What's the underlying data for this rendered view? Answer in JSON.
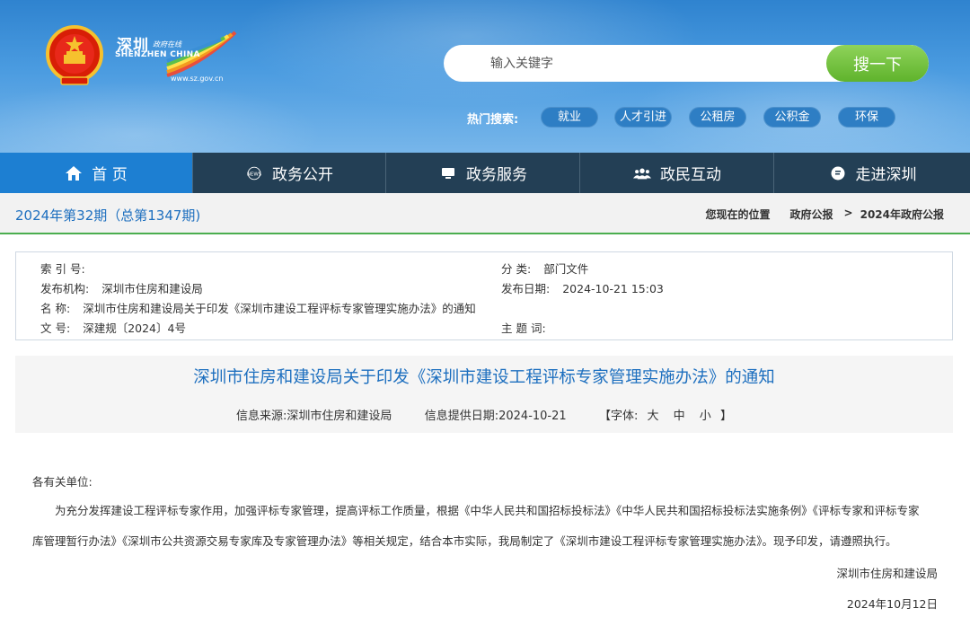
{
  "header": {
    "logo": {
      "cn_title": "深圳",
      "cn_subtitle": "政府在线",
      "en_title": "SHENZHEN CHINA",
      "url": "www.sz.gov.cn"
    },
    "search": {
      "placeholder": "输入关键字",
      "button_label": "搜一下"
    },
    "hot_search": {
      "label": "热门搜索:",
      "tags": [
        "就业",
        "人才引进",
        "公租房",
        "公积金",
        "环保"
      ]
    }
  },
  "nav": {
    "items": [
      {
        "label": "首 页",
        "icon": "home-icon",
        "active": true
      },
      {
        "label": "政务公开",
        "icon": "news-icon",
        "active": false
      },
      {
        "label": "政务服务",
        "icon": "monitor-icon",
        "active": false
      },
      {
        "label": "政民互动",
        "icon": "people-icon",
        "active": false
      },
      {
        "label": "走进深圳",
        "icon": "info-bubble-icon",
        "active": false
      }
    ]
  },
  "crumbbar": {
    "issue": "2024年第32期（总第1347期)",
    "location_label": "您现在的位置",
    "items": [
      "政府公报",
      "2024年政府公报"
    ],
    "separator": ">"
  },
  "meta": {
    "index_key": "索 引 号:",
    "index_value": "",
    "category_key": "分 类:",
    "category_value": "部门文件",
    "publisher_key": "发布机构:",
    "publisher_value": "深圳市住房和建设局",
    "date_key": "发布日期:",
    "date_value": "2024-10-21 15:03",
    "name_key": "名 称:",
    "name_value": "深圳市住房和建设局关于印发《深圳市建设工程评标专家管理实施办法》的通知",
    "keyword_key": "主 题 词:",
    "keyword_value": "",
    "doc_no_key": "文 号:",
    "doc_no_value": "深建规〔2024〕4号"
  },
  "article": {
    "title": "深圳市住房和建设局关于印发《深圳市建设工程评标专家管理实施办法》的通知",
    "source_label": "信息来源:",
    "source_value": "深圳市住房和建设局",
    "provide_date_label": "信息提供日期:",
    "provide_date_value": "2024-10-21",
    "font_label_open": "【字体:",
    "font_large": "大",
    "font_medium": "中",
    "font_small": "小",
    "font_label_close": "】",
    "salutation": "各有关单位:",
    "paragraph_line1": "为充分发挥建设工程评标专家作用，加强评标专家管理，提高评标工作质量，根据《中华人民共和国招标投标法》《中华人民共和国招标投标法实施条例》《评标专家和评标专家",
    "paragraph_line2": "库管理暂行办法》《深圳市公共资源交易专家库及专家管理办法》等相关规定，结合本市实际，我局制定了《深圳市建设工程评标专家管理实施办法》。现予印发，请遵照执行。",
    "signature": "深圳市住房和建设局",
    "sign_date": "2024年10月12日"
  }
}
